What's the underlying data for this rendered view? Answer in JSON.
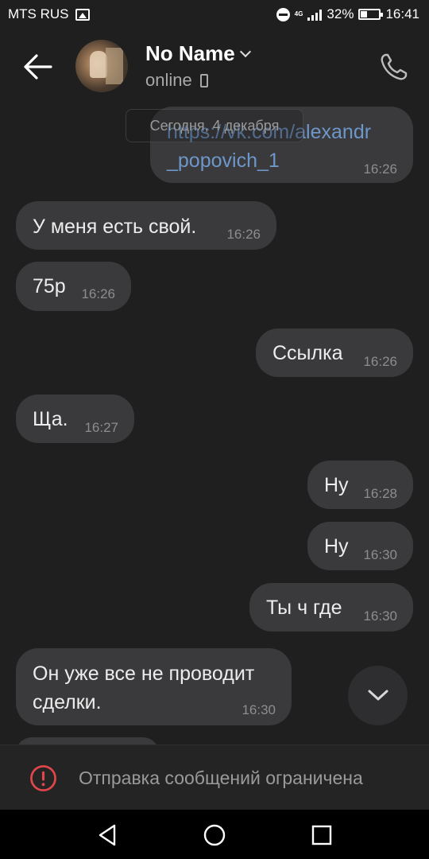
{
  "status_bar": {
    "carrier": "MTS RUS",
    "network": "4G",
    "battery": "32%",
    "time": "16:41"
  },
  "header": {
    "name": "No Name",
    "status": "online"
  },
  "date_chip": "Сегодня, 4 декабря",
  "messages": [
    {
      "side": "out",
      "text_line1": "https://vk.com/alexandr",
      "text_line2": "_popovich_1",
      "time": "16:26"
    },
    {
      "side": "in",
      "text": "У меня есть свой.",
      "time": "16:26"
    },
    {
      "side": "in",
      "text": "75р",
      "time": "16:26"
    },
    {
      "side": "out",
      "text": "Ссылка",
      "time": "16:26"
    },
    {
      "side": "in",
      "text": "Ща.",
      "time": "16:27"
    },
    {
      "side": "out",
      "text": "Ну",
      "time": "16:28"
    },
    {
      "side": "out",
      "text": "Ну",
      "time": "16:30"
    },
    {
      "side": "out",
      "text": "Ты ч где",
      "time": "16:30"
    },
    {
      "side": "in",
      "text_line1": "Он уже все не проводит",
      "text_line2": "сделки.",
      "time": "16:30"
    }
  ],
  "restriction": {
    "text": "Отправка сообщений ограничена"
  },
  "colors": {
    "background": "#1f1f1f",
    "bubble": "#3a3a3c",
    "link": "#6e97c9",
    "warning": "#e0464a"
  },
  "icons": [
    "back-arrow-icon",
    "chevron-down-icon",
    "phone-device-icon",
    "call-icon",
    "scroll-down-icon",
    "warning-icon",
    "nav-back-icon",
    "nav-home-icon",
    "nav-recents-icon"
  ]
}
